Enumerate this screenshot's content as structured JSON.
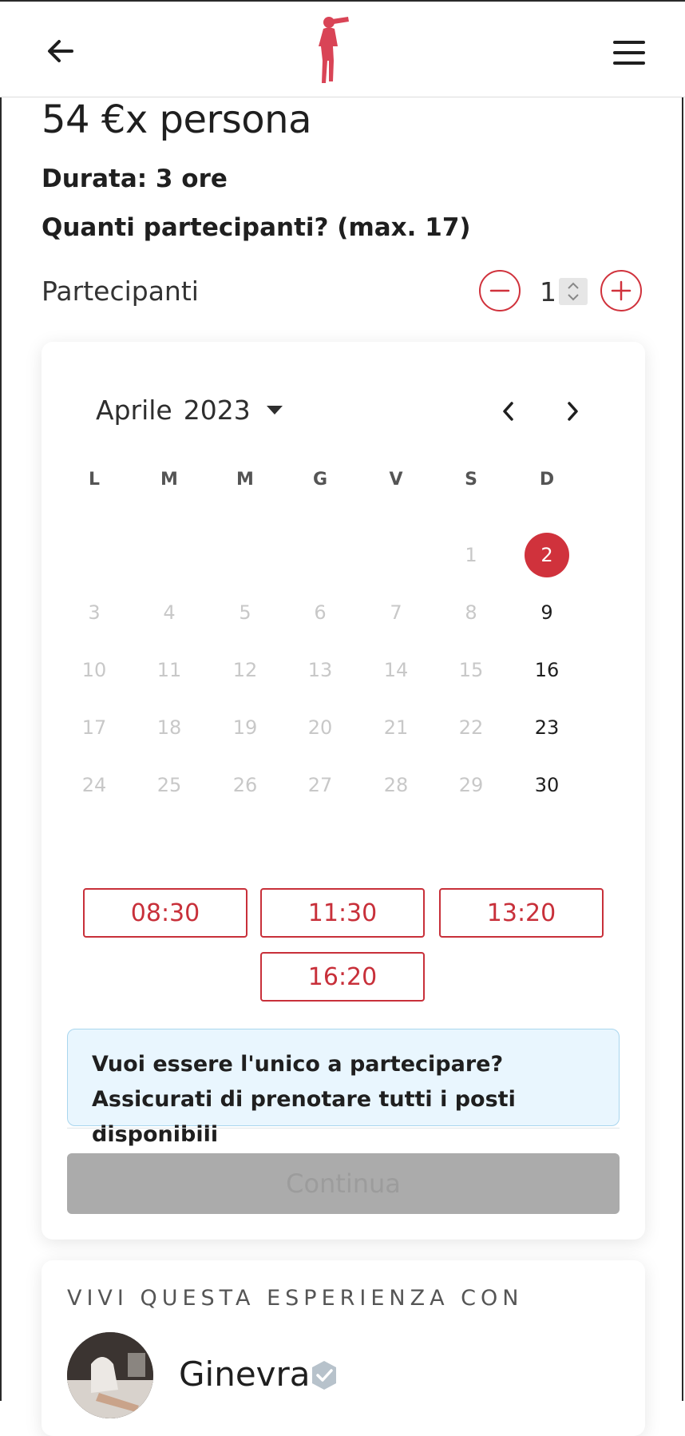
{
  "header": {
    "back_icon": "arrow-left-icon",
    "logo_icon": "explorer-silhouette-logo",
    "menu_icon": "hamburger-menu-icon",
    "brand_color": "#d0323c"
  },
  "booking": {
    "price": "54 €x persona",
    "duration": "Durata: 3 ore",
    "question": "Quanti partecipanti? (max. 17)",
    "participants_label": "Partecipanti",
    "participants_value": "1"
  },
  "calendar": {
    "month": "Aprile",
    "year": "2023",
    "weekdays": [
      "L",
      "M",
      "M",
      "G",
      "V",
      "S",
      "D"
    ],
    "days": [
      "1",
      "2",
      "3",
      "4",
      "5",
      "6",
      "7",
      "8",
      "9",
      "10",
      "11",
      "12",
      "13",
      "14",
      "15",
      "16",
      "17",
      "18",
      "19",
      "20",
      "21",
      "22",
      "23",
      "24",
      "25",
      "26",
      "27",
      "28",
      "29",
      "30"
    ],
    "available_days": [
      "2",
      "9",
      "16",
      "23",
      "30"
    ],
    "selected_day": "2",
    "selected_color": "#d0323c"
  },
  "time_slots": [
    "08:30",
    "11:30",
    "13:20",
    "16:20"
  ],
  "info_message": "Vuoi essere l'unico a partecipare? Assicurati di prenotare tutti i posti disponibili",
  "continue_label": "Continua",
  "host_section": {
    "title": "VIVI QUESTA ESPERIENZA CON",
    "host_name": "Ginevra",
    "verified_icon": "verified-badge-icon"
  }
}
